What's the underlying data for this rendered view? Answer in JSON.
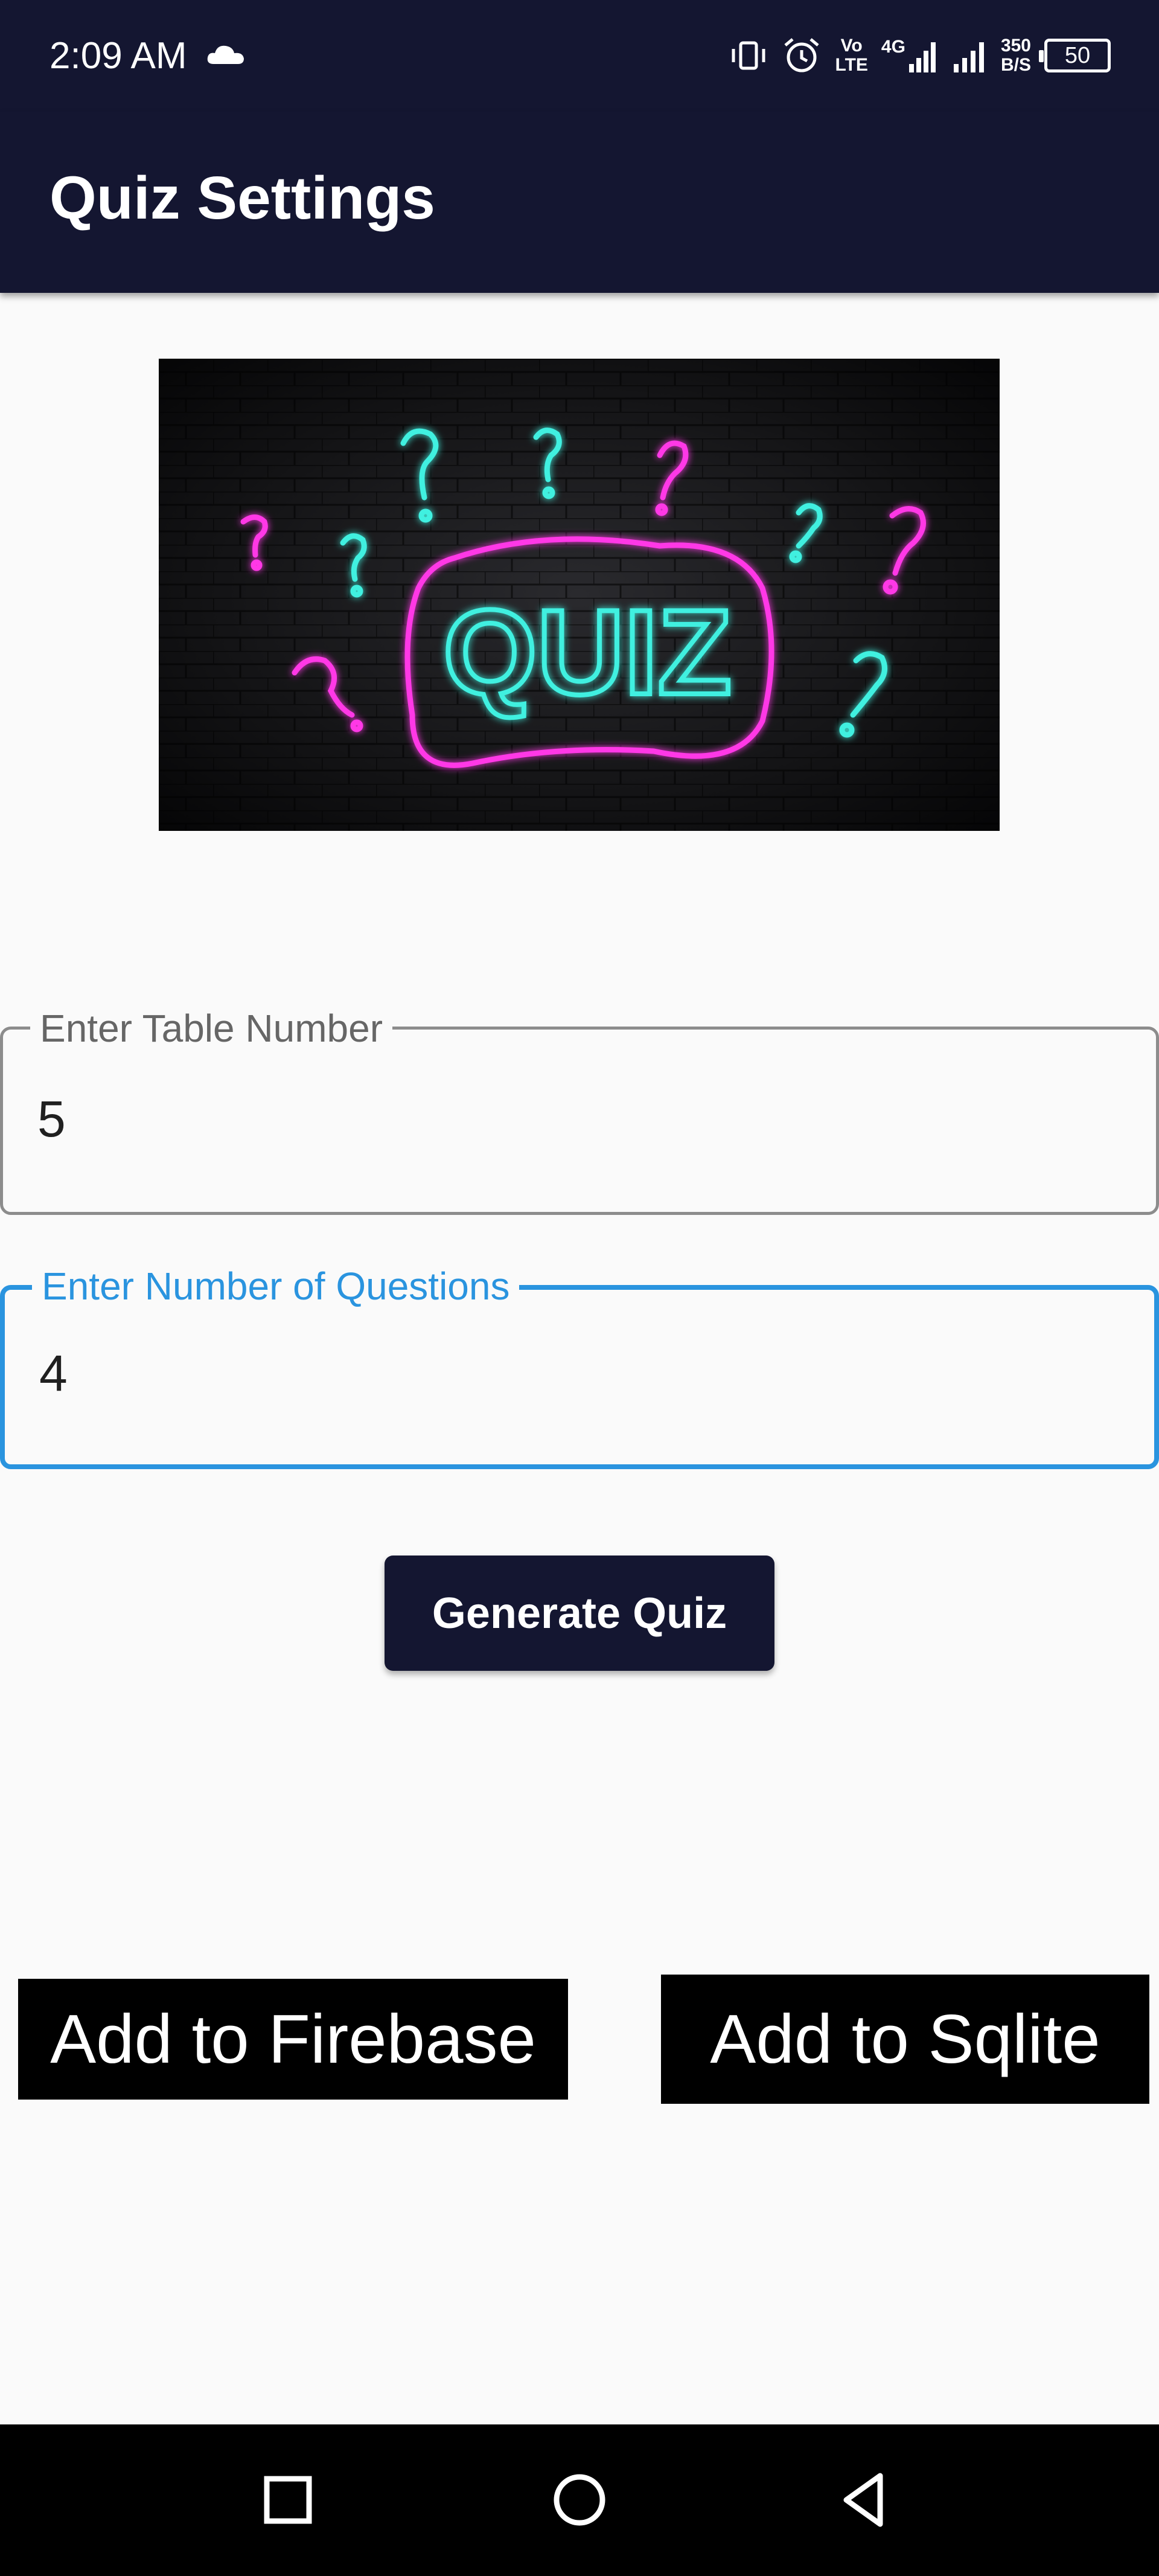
{
  "status_bar": {
    "time": "2:09 AM",
    "network_speed_top": "350",
    "network_speed_bottom": "B/S",
    "battery": "50",
    "volte_top": "Vo",
    "volte_bottom": "LTE",
    "net_type": "4G",
    "icons": [
      "cloud-icon",
      "vibrate-icon",
      "alarm-icon",
      "volte-icon",
      "signal-icon",
      "signal-icon",
      "battery-icon"
    ]
  },
  "app_bar": {
    "title": "Quiz Settings"
  },
  "banner": {
    "text": "QUIZ",
    "icon": "quiz-neon-image"
  },
  "form": {
    "table_number": {
      "label": "Enter Table Number",
      "value": "5"
    },
    "num_questions": {
      "label": "Enter Number of Questions",
      "value": "4"
    }
  },
  "buttons": {
    "generate": "Generate Quiz",
    "add_firebase": "Add to Firebase",
    "add_sqlite": "Add to Sqlite"
  },
  "nav_bar": {
    "icons": [
      "recents-icon",
      "home-icon",
      "back-icon"
    ]
  },
  "colors": {
    "primary_dark": "#141631",
    "focus_blue": "#2a94df",
    "neon_cyan": "#3ff0e0",
    "neon_pink": "#ff38e6"
  }
}
